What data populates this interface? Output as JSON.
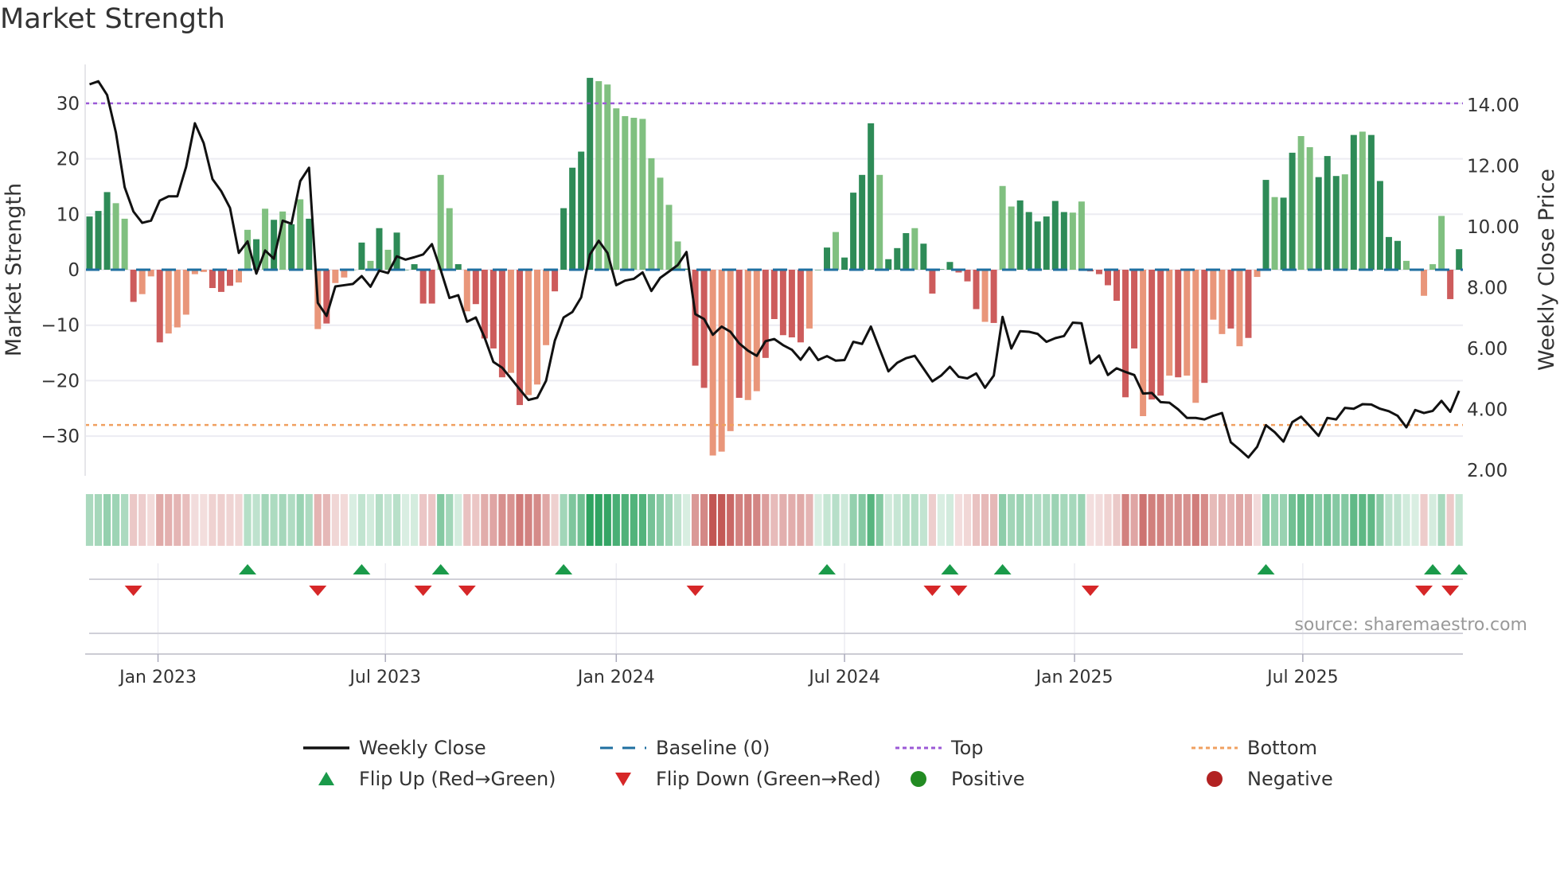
{
  "title": "Market Strength",
  "source": "source: sharemaestro.com",
  "chart_data": {
    "type": "bar+line",
    "title": "Market Strength",
    "ylabel": "Market Strength",
    "y2label": "Weekly Close Price",
    "ylim": [
      -37,
      37
    ],
    "y2lim": [
      1.8,
      15.2
    ],
    "yticks": [
      "30",
      "20",
      "10",
      "0",
      "−10",
      "−20",
      "−30"
    ],
    "ytick_values": [
      30,
      20,
      10,
      0,
      -10,
      -20,
      -30
    ],
    "y2ticks": [
      "14.00",
      "12.00",
      "10.00",
      "8.00",
      "6.00",
      "4.00",
      "2.00"
    ],
    "y2tick_values": [
      14,
      12,
      10,
      8,
      6,
      4,
      2
    ],
    "top_level": 30,
    "bottom_level": -28,
    "baseline": 0,
    "xticks": [
      {
        "label": "Jan 2023",
        "week": 7.8
      },
      {
        "label": "Jul 2023",
        "week": 33.7
      },
      {
        "label": "Jan 2024",
        "week": 60.0
      },
      {
        "label": "Jul 2024",
        "week": 86.0
      },
      {
        "label": "Jan 2025",
        "week": 112.2
      },
      {
        "label": "Jul 2025",
        "week": 138.2
      }
    ],
    "strength": [
      9.6,
      10.6,
      14.0,
      12.0,
      9.2,
      -5.8,
      -4.4,
      -1.2,
      -13.1,
      -11.5,
      -10.4,
      -8.1,
      -0.8,
      -0.4,
      -3.3,
      -4.0,
      -2.9,
      -2.3,
      7.2,
      5.5,
      11.0,
      9.0,
      10.5,
      8.2,
      12.7,
      9.2,
      -10.7,
      -9.7,
      -2.4,
      -1.4,
      0,
      4.9,
      1.6,
      7.5,
      3.6,
      6.7,
      0,
      1.0,
      -6.1,
      -6.1,
      17.1,
      11.1,
      1.0,
      -7.5,
      -6.2,
      -12.4,
      -14.2,
      -19.4,
      -18.6,
      -24.4,
      -22.6,
      -20.7,
      -13.6,
      -3.9,
      11.1,
      18.4,
      21.3,
      34.6,
      34.0,
      33.4,
      29.1,
      27.7,
      27.4,
      27.2,
      20.1,
      16.6,
      11.7,
      5.1,
      0.2,
      -17.3,
      -21.3,
      -33.5,
      -32.8,
      -29.1,
      -23.1,
      -23.5,
      -21.9,
      -15.9,
      -8.9,
      -11.8,
      -12.2,
      -13.1,
      -10.6,
      0,
      4.0,
      6.8,
      2.2,
      13.9,
      17.1,
      26.4,
      17.1,
      1.9,
      3.9,
      6.6,
      7.5,
      4.7,
      -4.3,
      0.1,
      1.4,
      -0.5,
      -2.1,
      -7.1,
      -9.4,
      -9.6,
      15.1,
      11.4,
      12.5,
      10.4,
      8.7,
      9.6,
      12.4,
      10.4,
      10.3,
      12.3,
      -0.3,
      -0.8,
      -2.8,
      -5.6,
      -23.0,
      -14.2,
      -26.4,
      -23.4,
      -22.7,
      -19.1,
      -19.4,
      -19.1,
      -24.0,
      -20.4,
      -9.0,
      -11.6,
      -10.6,
      -13.8,
      -12.3,
      -1.3,
      16.2,
      13.1,
      13.0,
      21.1,
      24.1,
      22.1,
      16.7,
      20.5,
      16.9,
      17.2,
      24.3,
      24.9,
      24.3,
      16.0,
      5.9,
      5.2,
      1.6,
      0,
      -4.7,
      1.0,
      9.7,
      -5.3,
      3.7
    ],
    "shade": "dddlldlldllllldddlldldldldldllldldldddddlldlddddldllldddddlllllllllldddllldlldddddlddlddddldddldddddddldllddddddllddddddlddldlldlldldldlddlldddldlddddllllldddddd",
    "weekly_close": [
      14.68,
      14.78,
      14.33,
      13.1,
      11.3,
      10.5,
      10.13,
      10.2,
      10.86,
      11.0,
      11.0,
      11.97,
      13.4,
      12.75,
      11.57,
      11.17,
      10.62,
      9.14,
      9.52,
      8.46,
      9.22,
      8.95,
      10.2,
      10.1,
      11.5,
      11.94,
      7.5,
      7.07,
      8.04,
      8.08,
      8.12,
      8.38,
      8.03,
      8.56,
      8.48,
      9.03,
      8.92,
      9.0,
      9.09,
      9.43,
      8.58,
      7.66,
      7.75,
      6.88,
      7.02,
      6.36,
      5.56,
      5.37,
      5.02,
      4.66,
      4.31,
      4.38,
      4.94,
      6.26,
      7.02,
      7.2,
      7.68,
      9.09,
      9.54,
      9.14,
      8.08,
      8.23,
      8.29,
      8.5,
      7.89,
      8.32,
      8.53,
      8.74,
      9.17,
      7.13,
      6.97,
      6.45,
      6.72,
      6.55,
      6.17,
      5.93,
      5.76,
      6.24,
      6.31,
      6.11,
      5.96,
      5.63,
      6.03,
      5.62,
      5.75,
      5.6,
      5.62,
      6.22,
      6.15,
      6.72,
      5.98,
      5.25,
      5.53,
      5.68,
      5.76,
      5.34,
      4.92,
      5.11,
      5.4,
      5.07,
      5.02,
      5.18,
      4.71,
      5.11,
      7.04,
      6.0,
      6.57,
      6.55,
      6.48,
      6.22,
      6.34,
      6.41,
      6.85,
      6.83,
      5.51,
      5.77,
      5.13,
      5.35,
      5.23,
      5.13,
      4.52,
      4.54,
      4.24,
      4.22,
      4.0,
      3.72,
      3.72,
      3.67,
      3.79,
      3.88,
      2.92,
      2.68,
      2.42,
      2.77,
      3.48,
      3.25,
      2.94,
      3.58,
      3.76,
      3.45,
      3.13,
      3.72,
      3.67,
      4.05,
      4.02,
      4.17,
      4.16,
      4.02,
      3.94,
      3.79,
      3.41,
      3.98,
      3.88,
      3.95,
      4.28,
      3.92,
      4.61
    ],
    "flip_up_weeks": [
      18,
      31,
      40,
      54,
      84,
      98,
      104,
      134,
      153,
      156
    ],
    "flip_down_weeks": [
      5,
      26,
      38,
      43,
      69,
      96,
      99,
      114,
      152,
      155
    ],
    "legend": [
      {
        "label": "Weekly Close",
        "kind": "line",
        "color": "#111111"
      },
      {
        "label": "Baseline (0)",
        "kind": "dash",
        "color": "#1f6fa0"
      },
      {
        "label": "Top",
        "kind": "dot",
        "color": "#9b59d6"
      },
      {
        "label": "Bottom",
        "kind": "dot",
        "color": "#f0a060"
      },
      {
        "label": "Flip Up (Red→Green)",
        "kind": "tri-up",
        "color": "#1a9a4a"
      },
      {
        "label": "Flip Down (Green→Red)",
        "kind": "tri-down",
        "color": "#d62728"
      },
      {
        "label": "Positive",
        "kind": "circle",
        "color": "#228b22"
      },
      {
        "label": "Negative",
        "kind": "circle",
        "color": "#b22222"
      }
    ],
    "legend_position": "bottom",
    "colors": {
      "pos_dark": "#2e8b57",
      "pos_light": "#80c080",
      "neg_dark": "#cd5c5c",
      "neg_light": "#e9967a",
      "heat_pos": "#2ca25f",
      "heat_neg": "#c0504d",
      "grid": "#ececf2"
    }
  }
}
